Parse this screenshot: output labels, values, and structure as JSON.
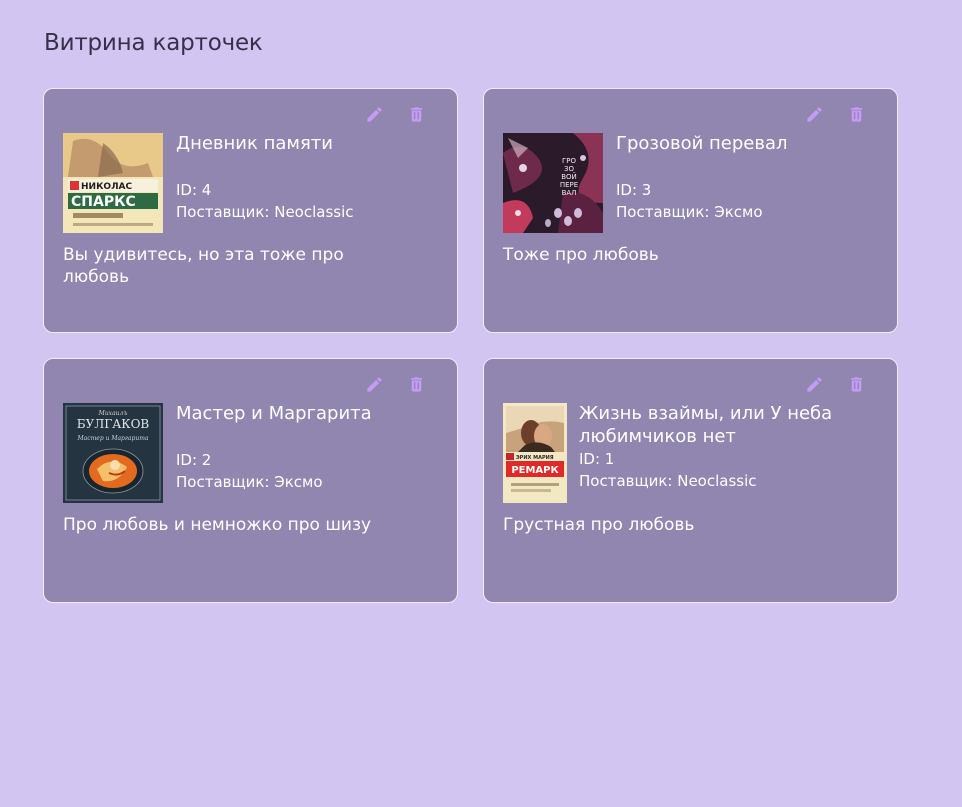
{
  "page": {
    "title": "Витрина карточек"
  },
  "colors": {
    "background": "#d3c5f2",
    "card": "#9186b0",
    "icon_accent": "#c59bf5"
  },
  "cards": [
    {
      "title": "Дневник памяти",
      "id_text": "ID: 4",
      "supplier_text": "Поставщик: Neoclassic",
      "description": "Вы удивитесь, но эта тоже про любовь",
      "cover": {
        "author": "НИКОЛАС",
        "name": "СПАРКС"
      }
    },
    {
      "title": "Грозовой перевал",
      "id_text": "ID: 3",
      "supplier_text": "Поставщик: Эксмо",
      "description": "Тоже про любовь",
      "cover": {
        "lines": [
          "ГРО",
          "ЗО",
          "ВОЙ",
          "ПЕРЕ",
          "ВАЛ"
        ]
      }
    },
    {
      "title": "Мастер и Маргарита",
      "id_text": "ID: 2",
      "supplier_text": "Поставщик: Эксмо",
      "description": "Про любовь и немножко про шизу",
      "cover": {
        "author_small": "Михаилъ",
        "author": "БУЛГАКОВ",
        "name": "Мастер и Маргарита"
      }
    },
    {
      "title": "Жизнь взаймы, или У неба любимчиков нет",
      "id_text": "ID: 1",
      "supplier_text": "Поставщик: Neoclassic",
      "description": "Грустная про любовь",
      "cover": {
        "author": "ЭРИХ МАРИЯ",
        "name": "РЕМАРК"
      }
    }
  ],
  "icons": {
    "edit": "pencil-icon",
    "delete": "trash-icon"
  }
}
